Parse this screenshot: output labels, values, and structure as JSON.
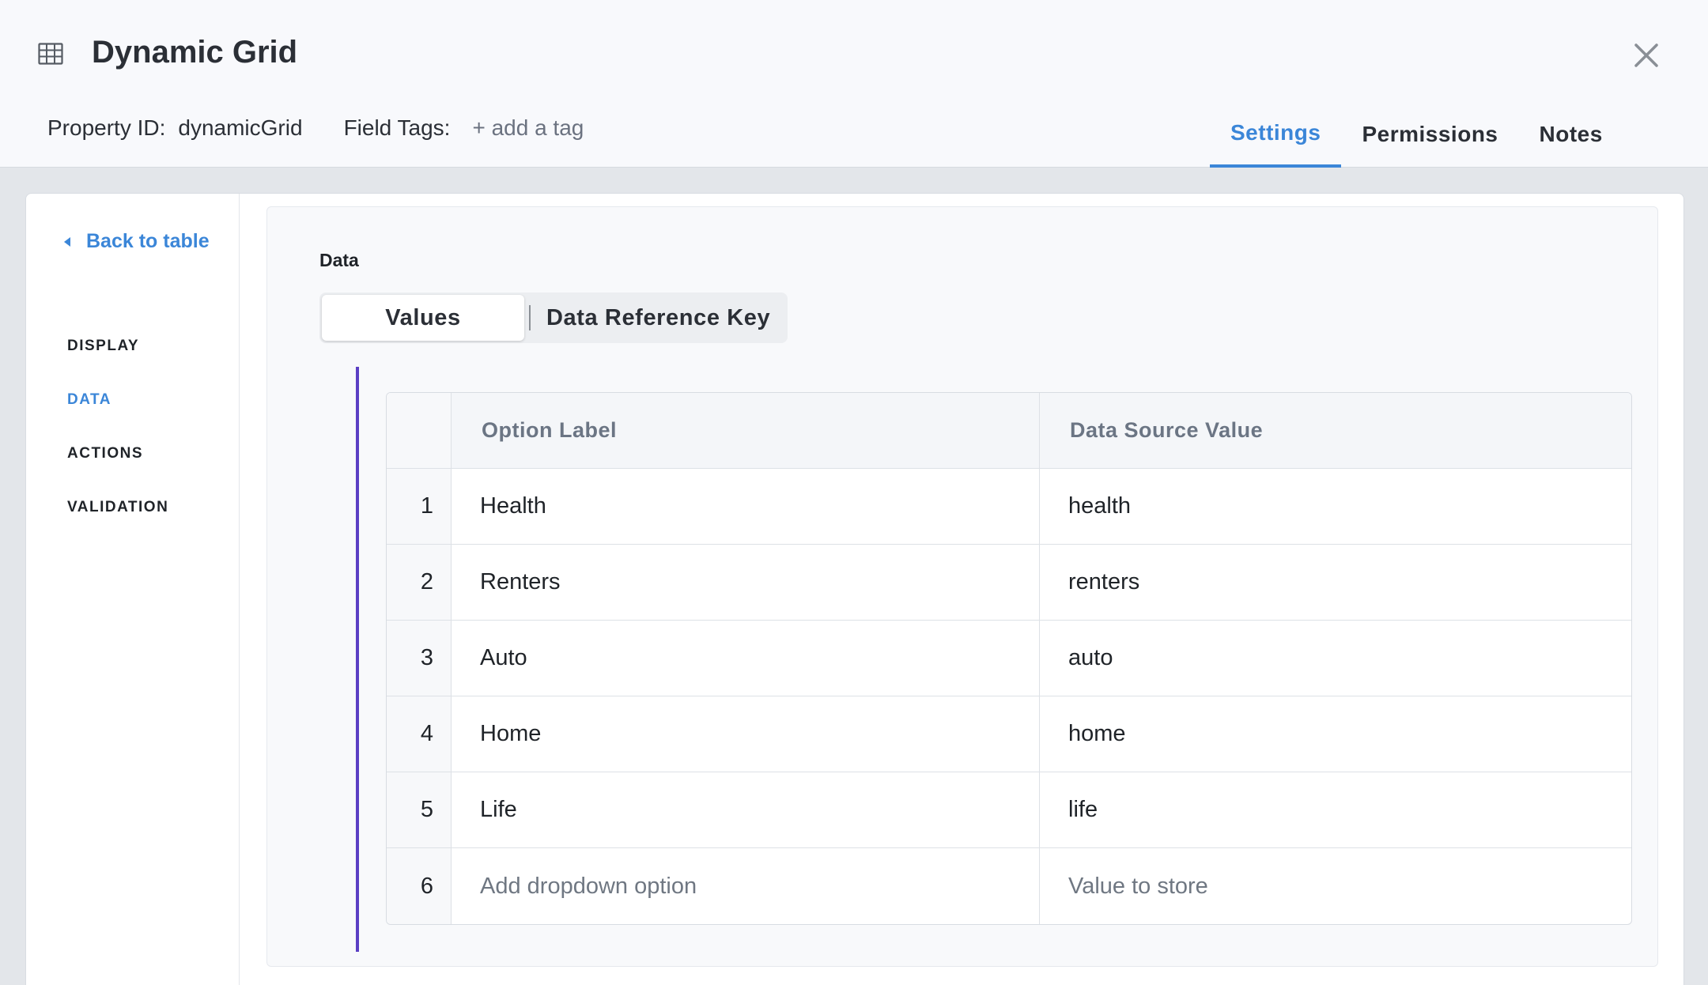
{
  "header": {
    "title": "Dynamic Grid",
    "property_id_label": "Property ID:",
    "property_id_value": "dynamicGrid",
    "field_tags_label": "Field Tags:",
    "add_tag_label": "+ add a tag",
    "tabs": [
      {
        "label": "Settings",
        "active": true
      },
      {
        "label": "Permissions",
        "active": false
      },
      {
        "label": "Notes",
        "active": false
      }
    ]
  },
  "sidebar": {
    "back_label": "Back to table",
    "items": [
      {
        "label": "DISPLAY",
        "active": false
      },
      {
        "label": "DATA",
        "active": true
      },
      {
        "label": "ACTIONS",
        "active": false
      },
      {
        "label": "VALIDATION",
        "active": false
      }
    ]
  },
  "main": {
    "section_title": "Data",
    "segments": [
      {
        "label": "Values",
        "active": true
      },
      {
        "label": "Data Reference Key",
        "active": false
      }
    ],
    "table": {
      "columns": [
        "",
        "Option Label",
        "Data Source Value"
      ],
      "rows": [
        {
          "num": "1",
          "label": "Health",
          "value": "health"
        },
        {
          "num": "2",
          "label": "Renters",
          "value": "renters"
        },
        {
          "num": "3",
          "label": "Auto",
          "value": "auto"
        },
        {
          "num": "4",
          "label": "Home",
          "value": "home"
        },
        {
          "num": "5",
          "label": "Life",
          "value": "life"
        }
      ],
      "new_row": {
        "num": "6",
        "label_placeholder": "Add dropdown option",
        "value_placeholder": "Value to store"
      }
    }
  },
  "colors": {
    "accent": "#3b86d8",
    "accent_bar": "#5b3fc4"
  },
  "icons": {
    "title_icon": "table-grid-icon",
    "close": "close-icon",
    "back": "caret-left-icon"
  }
}
